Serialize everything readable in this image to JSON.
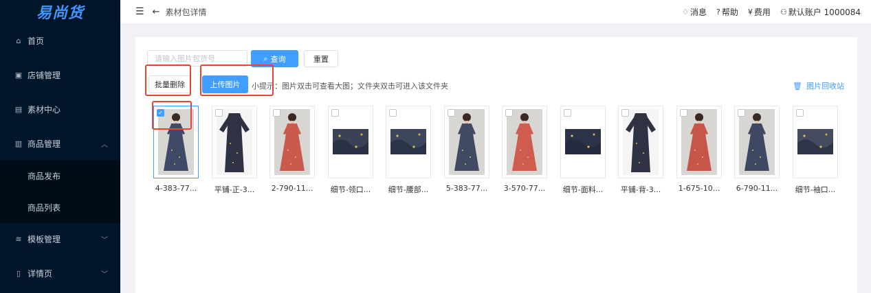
{
  "app": {
    "logo_text": "易尚货"
  },
  "sidebar": {
    "items": [
      {
        "label": "首页",
        "icon": "home-icon",
        "glyph": "⌂"
      },
      {
        "label": "店铺管理",
        "icon": "store-icon",
        "glyph": "▣"
      },
      {
        "label": "素材中心",
        "icon": "image-icon",
        "glyph": "▤"
      },
      {
        "label": "商品管理",
        "icon": "chart-icon",
        "glyph": "▥",
        "chevron": "︿"
      },
      {
        "label": "商品发布",
        "sub": true
      },
      {
        "label": "商品列表",
        "sub": true
      },
      {
        "label": "模板管理",
        "icon": "template-icon",
        "glyph": "≋",
        "chevron": "﹀"
      },
      {
        "label": "详情页",
        "icon": "document-icon",
        "glyph": "▯",
        "chevron": "﹀"
      }
    ]
  },
  "header": {
    "breadcrumb": "素材包详情",
    "links": [
      {
        "label": "消息",
        "glyph": "♢",
        "icon": "bell-icon"
      },
      {
        "label": "帮助",
        "glyph": "?",
        "icon": "help-icon"
      },
      {
        "label": "费用",
        "glyph": "¥",
        "icon": "yen-icon"
      },
      {
        "label": "默认账户 1000084",
        "glyph": "⚇",
        "icon": "user-icon"
      }
    ]
  },
  "toolbar": {
    "search_placeholder": "请输入图片包货号",
    "query_label": "查询",
    "reset_label": "重置",
    "batch_delete_label": "批量删除",
    "upload_label": "上传图片",
    "tip": "小提示：图片双击可查看大图；文件夹双击可进入该文件夹",
    "recycle_label": "图片回收站"
  },
  "colors": {
    "primary": "#409eff",
    "sidebar": "#001529",
    "highlight": "#e8452f"
  },
  "images": [
    {
      "caption": "4-383-77...",
      "kind": "model",
      "dress": "#3f4a66",
      "checked": true
    },
    {
      "caption": "平铺-正-3...",
      "kind": "flat",
      "dress": "#2f3242",
      "checked": false
    },
    {
      "caption": "2-790-11...",
      "kind": "model",
      "dress": "#c95a4c",
      "checked": false
    },
    {
      "caption": "细节-领口...",
      "kind": "detail",
      "dress": "#3b4256",
      "checked": false
    },
    {
      "caption": "细节-腰部...",
      "kind": "detail",
      "dress": "#3c465c",
      "checked": false
    },
    {
      "caption": "5-383-77...",
      "kind": "model",
      "dress": "#414a63",
      "checked": false
    },
    {
      "caption": "3-570-77...",
      "kind": "model",
      "dress": "#cf5c4f",
      "checked": false
    },
    {
      "caption": "细节-面料...",
      "kind": "detail",
      "dress": "#2c3347",
      "checked": false
    },
    {
      "caption": "平铺-背-3...",
      "kind": "flat",
      "dress": "#2f3242",
      "checked": false
    },
    {
      "caption": "1-675-10...",
      "kind": "model",
      "dress": "#c75549",
      "checked": false
    },
    {
      "caption": "6-790-11...",
      "kind": "model",
      "dress": "#3e4863",
      "checked": false
    },
    {
      "caption": "细节-袖口...",
      "kind": "detail",
      "dress": "#454c60",
      "checked": false
    }
  ]
}
